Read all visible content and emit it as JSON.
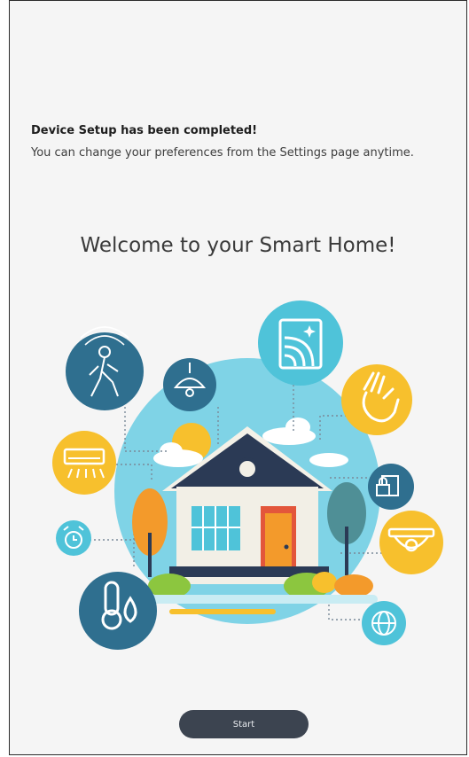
{
  "message": {
    "title": "Device Setup has been completed!",
    "body": "You can change your preferences from the Settings page anytime."
  },
  "welcome": "Welcome to your Smart Home!",
  "illustration": {
    "icons": [
      "motion-sensor-icon",
      "ceiling-lamp-icon",
      "smart-display-icon",
      "gesture-hand-icon",
      "air-conditioner-icon",
      "smart-lock-icon",
      "alarm-clock-icon",
      "security-camera-icon",
      "temperature-humidity-icon",
      "globe-icon"
    ],
    "colors": {
      "teal_dark": "#2f6f8f",
      "teal_light": "#4fc3d9",
      "sky": "#7fd3e6",
      "yellow": "#f7c02d",
      "orange": "#f39a2b",
      "green": "#8cc63f",
      "navy": "#2b3a55",
      "red": "#e3563b"
    }
  },
  "start_button": "Start"
}
